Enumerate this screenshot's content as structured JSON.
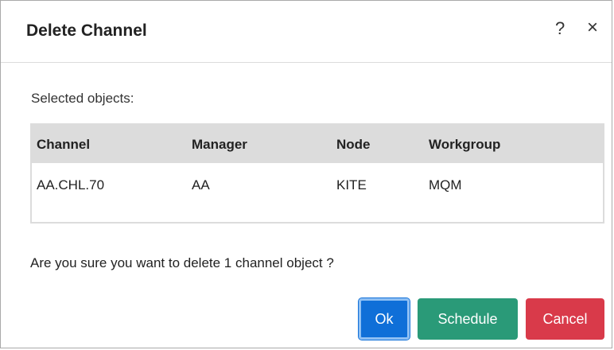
{
  "dialog": {
    "title": "Delete Channel",
    "help_icon": "?",
    "close_icon": "×"
  },
  "selected_label": "Selected objects:",
  "table": {
    "headers": [
      "Channel",
      "Manager",
      "Node",
      "Workgroup"
    ],
    "rows": [
      [
        "AA.CHL.70",
        "AA",
        "KITE",
        "MQM"
      ]
    ]
  },
  "confirm_text": "Are you sure you want to delete 1 channel object ?",
  "buttons": {
    "ok": "Ok",
    "schedule": "Schedule",
    "cancel": "Cancel"
  },
  "colors": {
    "ok": "#0f6fd8",
    "schedule": "#2a9a78",
    "cancel": "#d93a4a",
    "table_header": "#dcdcdc"
  }
}
